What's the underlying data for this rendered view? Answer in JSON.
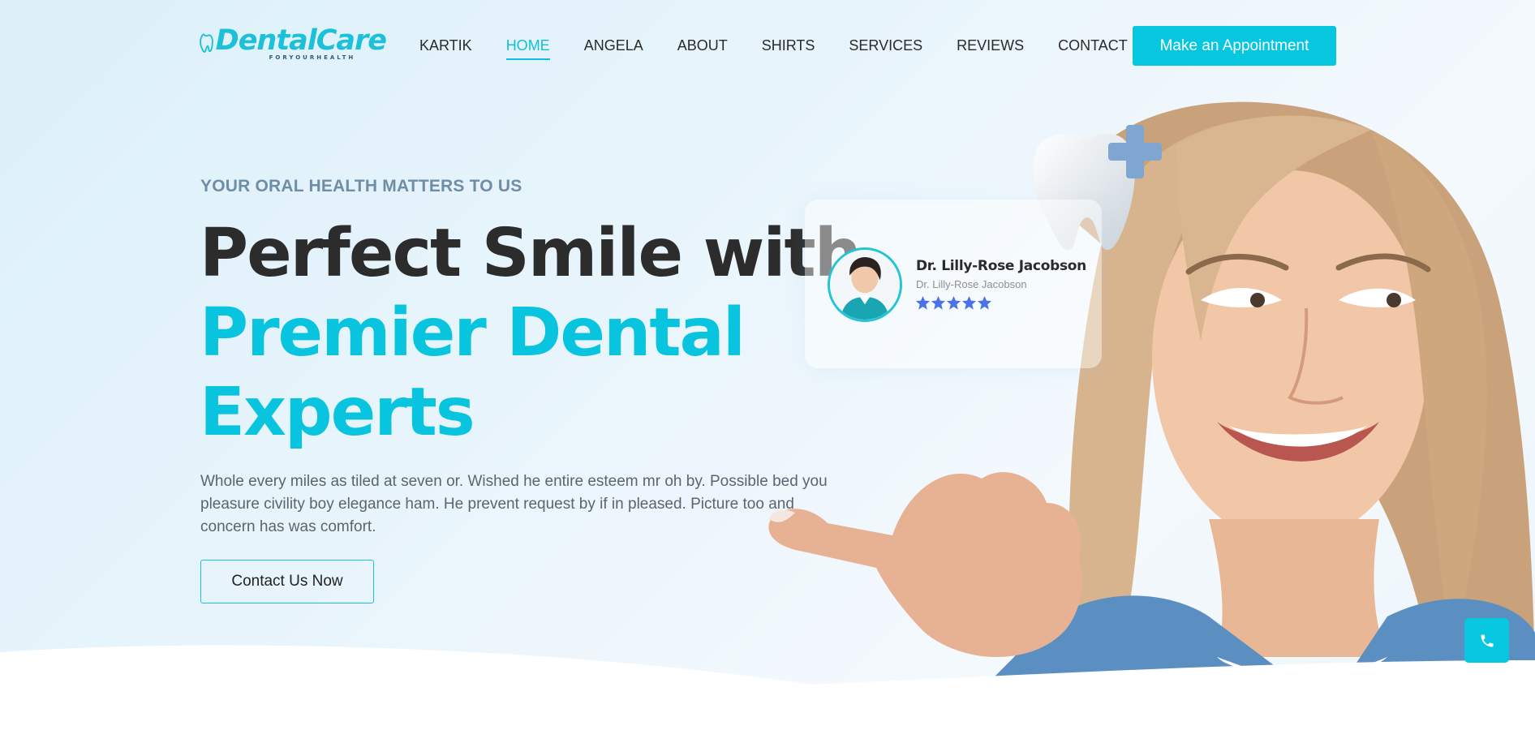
{
  "brand": {
    "name": "DentalCare",
    "tagline": "FORYOURHEALTH",
    "accent": "#06c6e0",
    "dark": "#2c2c2c"
  },
  "nav": {
    "items": [
      "KARTIK",
      "HOME",
      "ANGELA",
      "ABOUT",
      "SHIRTS",
      "SERVICES",
      "REVIEWS",
      "CONTACT"
    ],
    "active": "HOME"
  },
  "header": {
    "cta_label": "Make an Appointment"
  },
  "hero": {
    "eyebrow": "YOUR ORAL HEALTH MATTERS TO US",
    "headline_line1": "Perfect Smile with",
    "headline_line2": "Premier Dental",
    "headline_line3": "Experts",
    "description": "Whole every miles as tiled at seven or. Wished he entire esteem mr oh by. Possible bed you pleasure civility boy elegance ham. He prevent request by if in pleased. Picture too and concern has was comfort.",
    "contact_label": "Contact Us Now"
  },
  "doctor_card": {
    "name": "Dr. Lilly-Rose Jacobson",
    "title": "Dr. Lilly-Rose Jacobson",
    "rating": 5,
    "star_color": "#4a73e8"
  },
  "icons": {
    "logo": "tooth-logo-icon",
    "phone": "phone-icon",
    "star": "star-icon"
  }
}
